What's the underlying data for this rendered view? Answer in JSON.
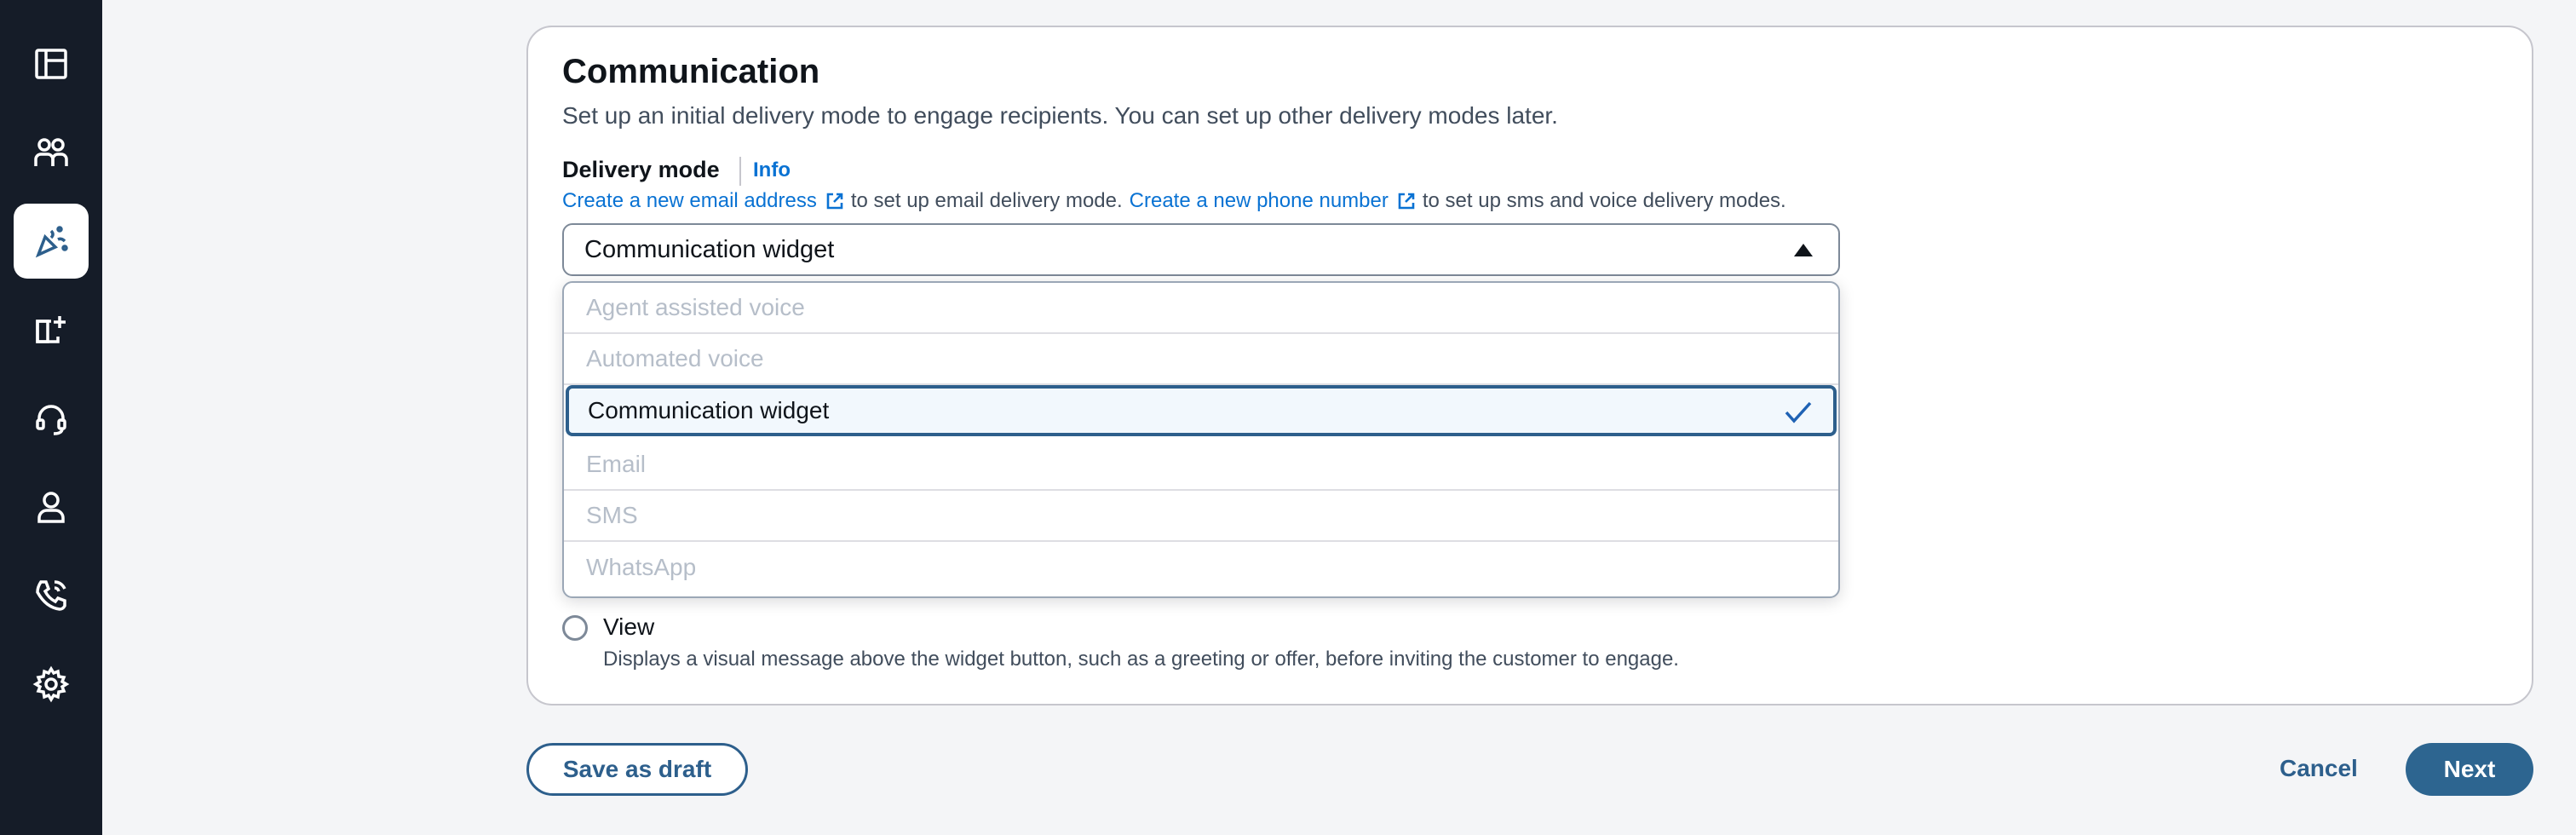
{
  "sidebar": {
    "items": [
      {
        "icon": "dashboard-icon"
      },
      {
        "icon": "users-icon"
      },
      {
        "icon": "campaigns-icon",
        "active": true
      },
      {
        "icon": "routing-icon"
      },
      {
        "icon": "headset-icon"
      },
      {
        "icon": "user-icon"
      },
      {
        "icon": "phone-icon"
      },
      {
        "icon": "gear-icon"
      }
    ]
  },
  "section": {
    "title": "Communication",
    "subtitle": "Set up an initial delivery mode to engage recipients. You can set up other delivery modes later."
  },
  "delivery_mode": {
    "label": "Delivery mode",
    "info_label": "Info",
    "hint": {
      "email_link": "Create a new email address",
      "email_text": "to set up email delivery mode.",
      "phone_link": "Create a new phone number",
      "phone_text": "to set up sms and voice delivery modes."
    },
    "selected": "Communication widget",
    "options": [
      {
        "label": "Agent assisted voice",
        "disabled": true
      },
      {
        "label": "Automated voice",
        "disabled": true
      },
      {
        "label": "Communication widget",
        "selected": true
      },
      {
        "label": "Email",
        "disabled": true
      },
      {
        "label": "SMS",
        "disabled": true
      },
      {
        "label": "WhatsApp",
        "disabled": true
      }
    ]
  },
  "view_option": {
    "label": "View",
    "description": "Displays a visual message above the widget button, such as a greeting or offer, before inviting the customer to engage."
  },
  "footer": {
    "save_draft_label": "Save as draft",
    "cancel_label": "Cancel",
    "next_label": "Next"
  },
  "colors": {
    "sidebar_bg": "#151c28",
    "link": "#0972d3",
    "primary": "#2d6590"
  }
}
